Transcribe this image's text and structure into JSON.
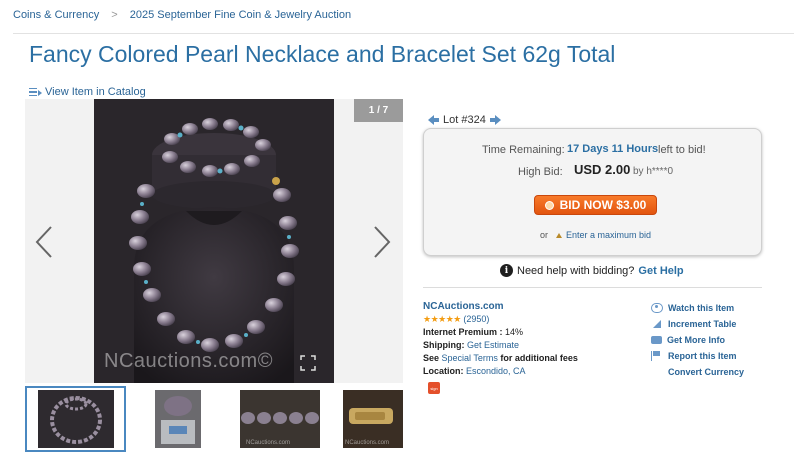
{
  "breadcrumb": {
    "items": [
      "Coins & Currency",
      "2025 September Fine Coin & Jewelry Auction"
    ],
    "separator": ">"
  },
  "title": "Fancy Colored Pearl Necklace and Bracelet Set 62g Total",
  "catalog_link": "View Item in Catalog",
  "gallery": {
    "counter": "1 / 7",
    "watermark": "NCauctions.com©",
    "thumb_watermark_1": "NCauctions.com",
    "thumb_watermark_2": "NCauctions.com"
  },
  "lot": {
    "label": "Lot #324"
  },
  "bid_box": {
    "time_label": "Time Remaining:",
    "time_value": "17 Days 11 Hours",
    "time_tail": "left to bid!",
    "high_label": "High Bid:",
    "high_value": "USD 2.00",
    "high_by": "by h****0",
    "bid_button": "BID NOW $3.00",
    "max_prefix": "or",
    "max_link": "Enter a maximum bid"
  },
  "help": {
    "text": "Need help with bidding?",
    "link": "Get Help",
    "icon": "i"
  },
  "seller": {
    "name": "NCAuctions.com",
    "stars": "★★★★★",
    "rating": "(2950)",
    "premium_label": "Internet Premium :",
    "premium_value": "14%",
    "shipping_label": "Shipping:",
    "shipping_value": "Get Estimate",
    "see": "See",
    "special_terms": "Special Terms",
    "fees": "for additional fees",
    "location_label": "Location:",
    "location_value": "Escondido, CA",
    "badge": "sign"
  },
  "actions": [
    {
      "label": "Watch this Item",
      "icon": "eye-icon"
    },
    {
      "label": "Increment Table",
      "icon": "triangle-icon"
    },
    {
      "label": "Get More Info",
      "icon": "message-icon"
    },
    {
      "label": "Report this Item",
      "icon": "flag-icon"
    },
    {
      "label": "Convert Currency",
      "icon": ""
    }
  ],
  "colors": {
    "link": "#2a6496",
    "title": "#2b6fa3",
    "bid_button": "#ef6a1c",
    "star": "#f39c12"
  }
}
